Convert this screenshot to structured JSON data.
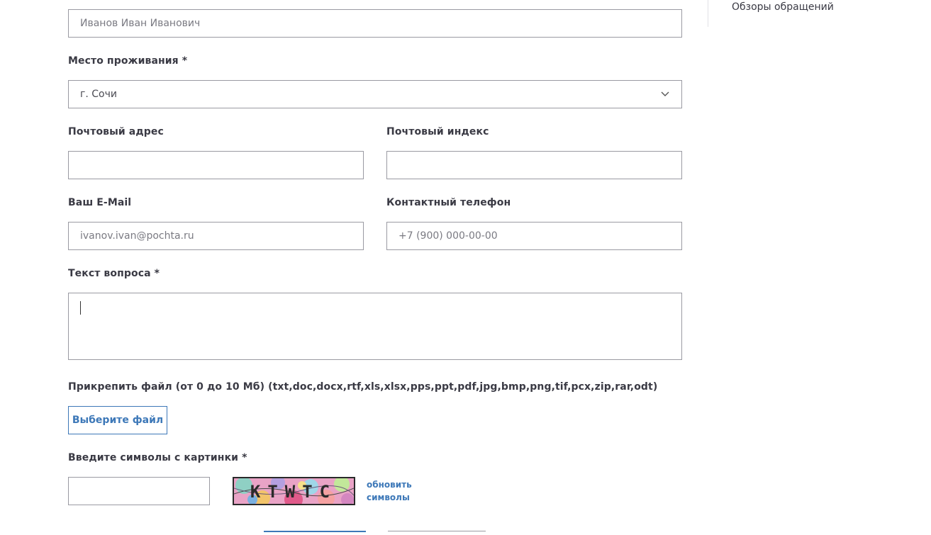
{
  "sidebar": {
    "link_label": "Обзоры обращений"
  },
  "form": {
    "full_name": {
      "placeholder": "Иванов Иван Иванович"
    },
    "residence": {
      "label": "Место проживания *",
      "value": "г. Сочи"
    },
    "postal_address": {
      "label": "Почтовый адрес",
      "value": ""
    },
    "postal_index": {
      "label": "Почтовый индекс",
      "value": ""
    },
    "email": {
      "label": "Ваш E-Mail",
      "placeholder": "ivanov.ivan@pochta.ru"
    },
    "phone": {
      "label": "Контактный телефон",
      "placeholder": "+7 (900) 000-00-00"
    },
    "question": {
      "label": "Текст вопроса *",
      "value": ""
    },
    "attachment": {
      "label": "Прикрепить файл (от 0 до 10 Мб) (txt,doc,docx,rtf,xls,xlsx,pps,ppt,pdf,jpg,bmp,png,tif,pcx,zip,rar,odt)",
      "button_label": "Выберите файл"
    },
    "captcha": {
      "label": "Введите символы с картинки *",
      "value": "",
      "image_text": "KTWTC",
      "refresh_line1": "обновить",
      "refresh_line2": "символы"
    }
  },
  "colors": {
    "accent": "#3d78b8",
    "border": "#9a9aa2",
    "text": "#3a3a44"
  }
}
